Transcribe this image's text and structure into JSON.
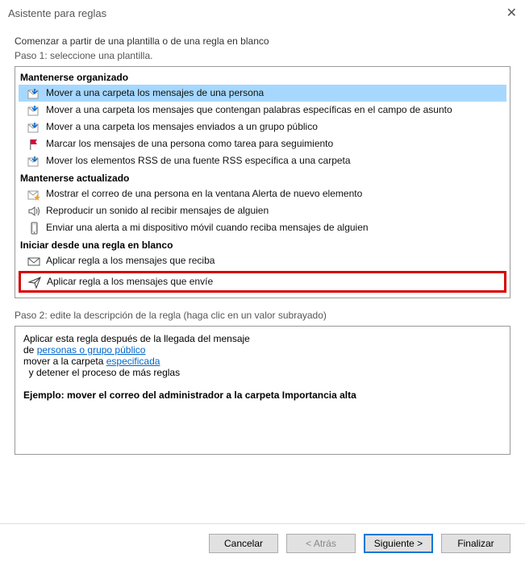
{
  "window": {
    "title": "Asistente para reglas"
  },
  "intro": "Comenzar a partir de una plantilla o de una regla en blanco",
  "step1_label": "Paso 1: seleccione una plantilla.",
  "sections": {
    "organized": {
      "header": "Mantenerse organizado",
      "items": [
        "Mover a una carpeta los mensajes de una persona",
        "Mover a una carpeta los mensajes que contengan palabras específicas en el campo de asunto",
        "Mover a una carpeta los mensajes enviados a un grupo público",
        "Marcar los mensajes de una persona como tarea para seguimiento",
        "Mover los elementos RSS de una fuente RSS específica a una carpeta"
      ]
    },
    "updated": {
      "header": "Mantenerse actualizado",
      "items": [
        "Mostrar el correo de una persona en la ventana Alerta de nuevo elemento",
        "Reproducir un sonido al recibir mensajes de alguien",
        "Enviar una alerta a mi dispositivo móvil cuando reciba mensajes de alguien"
      ]
    },
    "blank": {
      "header": "Iniciar desde una regla en blanco",
      "items": [
        "Aplicar regla a los mensajes que reciba",
        "Aplicar regla a los mensajes que envíe"
      ]
    }
  },
  "step2_label": "Paso 2: edite la descripción de la regla (haga clic en un valor subrayado)",
  "description": {
    "line1": "Aplicar esta regla después de la llegada del mensaje",
    "line2_prefix": "de ",
    "line2_link": "personas o grupo público",
    "line3_prefix": "mover a la carpeta ",
    "line3_link": "especificada",
    "line4": "  y detener el proceso de más reglas",
    "example": "Ejemplo: mover el correo del administrador a la carpeta Importancia alta"
  },
  "buttons": {
    "cancel": "Cancelar",
    "back": "< Atrás",
    "next": "Siguiente >",
    "finish": "Finalizar"
  }
}
